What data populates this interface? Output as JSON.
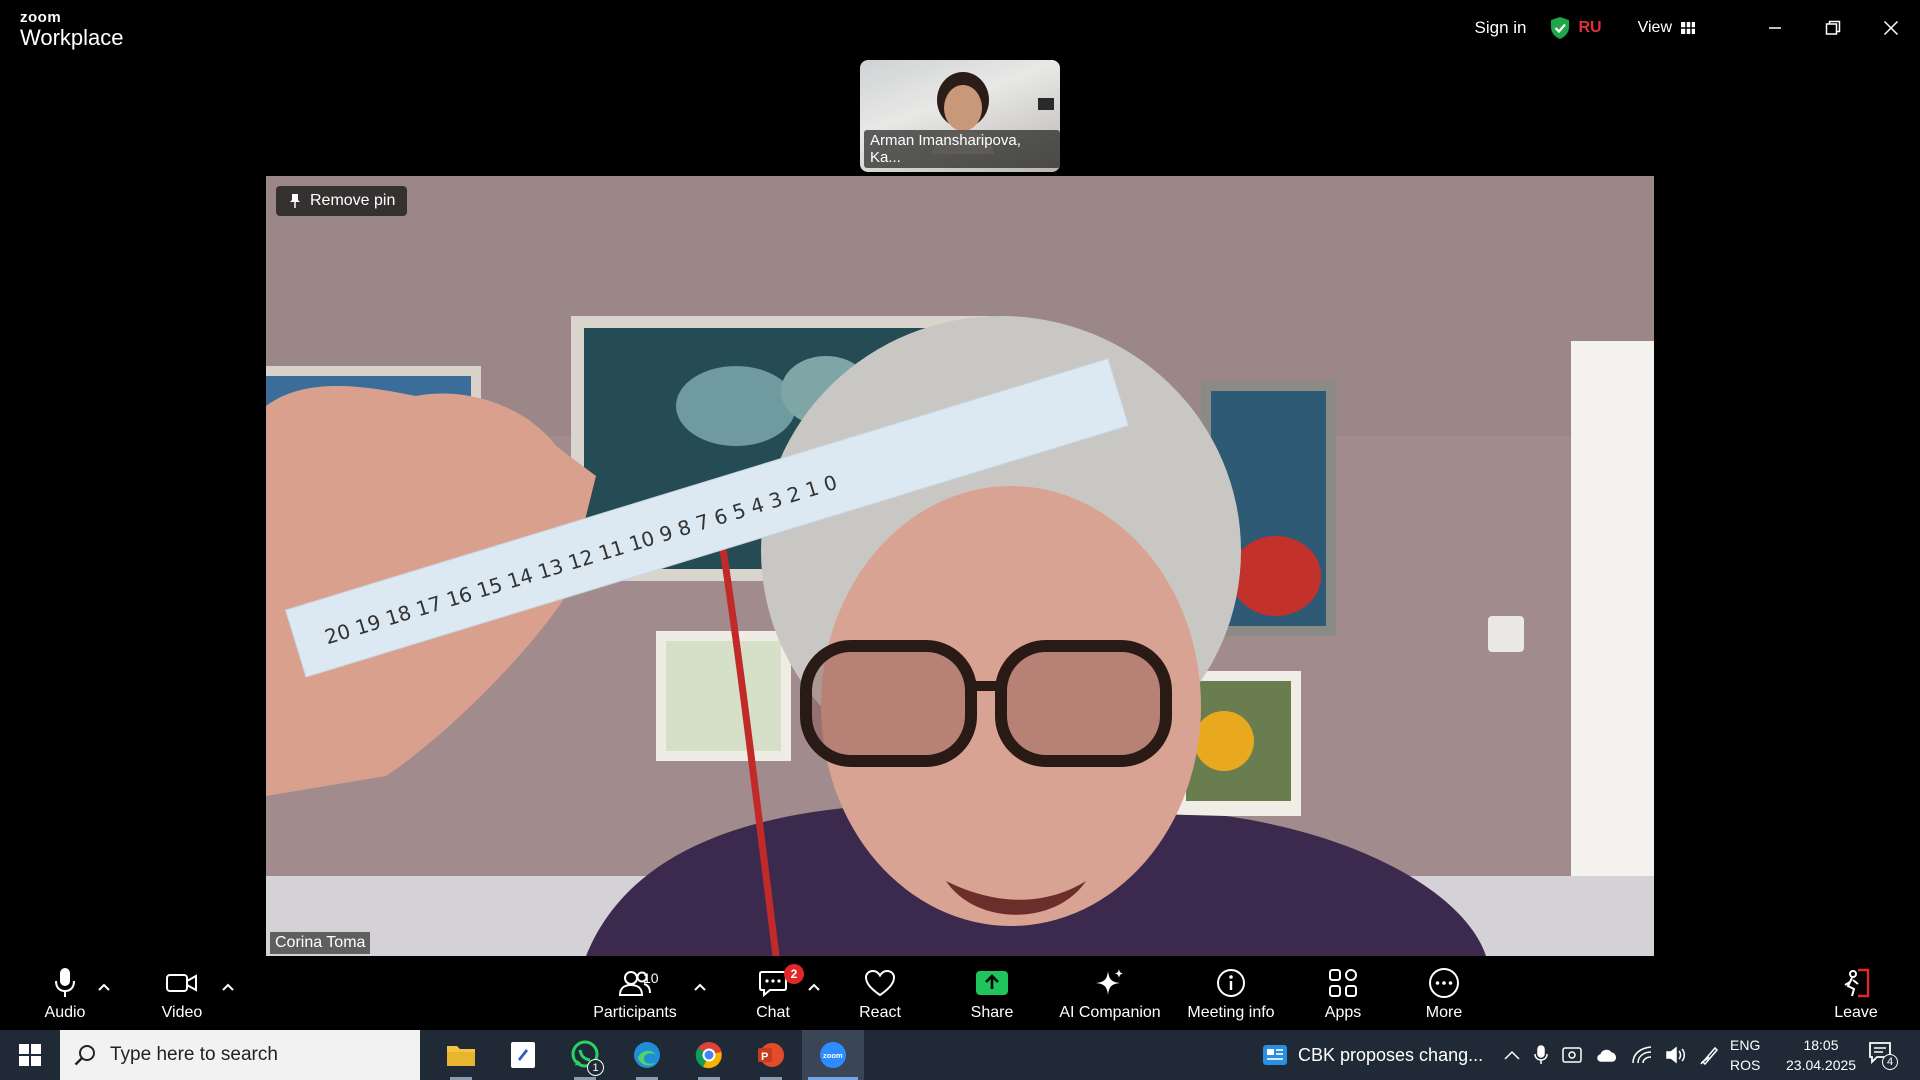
{
  "app": {
    "brand_top": "zoom",
    "brand_bottom": "Workplace"
  },
  "topbar": {
    "signin_label": "Sign in",
    "region": "RU",
    "view_label": "View",
    "shield_color": "#1fa64a",
    "region_color": "#e0313b"
  },
  "thumbnail": {
    "participant_name": "Arman Imansharipova, Ka..."
  },
  "main_video": {
    "pin_label": "Remove pin",
    "participant_name": "Corina Toma"
  },
  "toolbar": {
    "audio_label": "Audio",
    "video_label": "Video",
    "participants_label": "Participants",
    "participants_count": "10",
    "chat_label": "Chat",
    "chat_badge": "2",
    "react_label": "React",
    "share_label": "Share",
    "ai_label": "AI Companion",
    "meeting_info_label": "Meeting info",
    "apps_label": "Apps",
    "more_label": "More",
    "leave_label": "Leave",
    "share_color": "#1fc45c",
    "leave_color": "#e02828"
  },
  "taskbar": {
    "search_placeholder": "Type here to search",
    "whatsapp_badge": "1",
    "news_text": "CBK proposes chang...",
    "lang_top": "ENG",
    "lang_bottom": "ROS",
    "time": "18:05",
    "date": "23.04.2025",
    "notifications_count": "4"
  }
}
